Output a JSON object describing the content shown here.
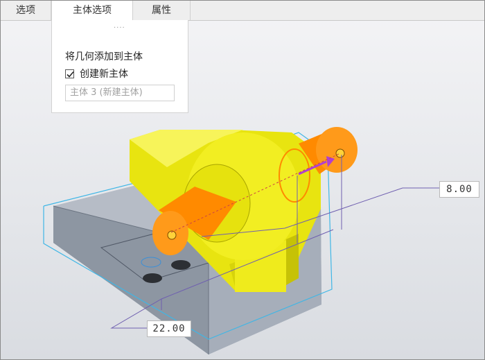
{
  "tabs": [
    {
      "label": "选项"
    },
    {
      "label": "主体选项",
      "active": true
    },
    {
      "label": "属性"
    }
  ],
  "panel": {
    "grip": "····",
    "add_to_body_label": "将几何添加到主体",
    "create_new_body": {
      "label": "创建新主体",
      "checked": true
    },
    "body_field_value": "主体 3 (新建主体)"
  },
  "dimensions": {
    "length": "8.00",
    "diameter": "22.00"
  },
  "colors": {
    "plate": "#a8b0bd",
    "bracket": "#f0ec10",
    "shaft": "#ff8c00",
    "drag_arrow": "#b040d0",
    "dim_line": "#6f5fb0"
  }
}
